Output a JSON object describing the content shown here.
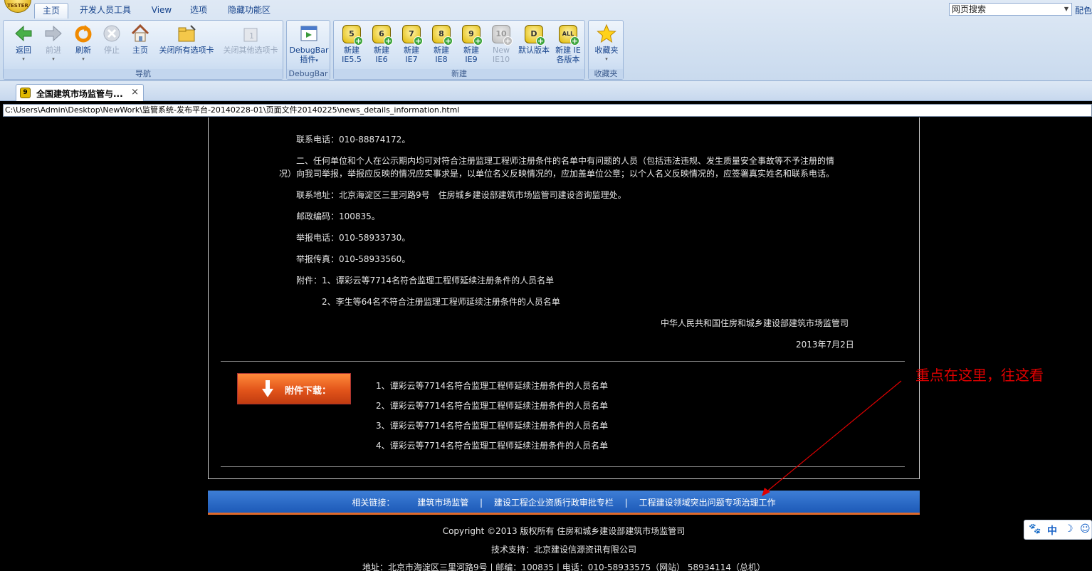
{
  "ribbon": {
    "logo_text": "TESTER",
    "tabs": [
      "主页",
      "开发人员工具",
      "View",
      "选项",
      "隐藏功能区"
    ],
    "search_value": "网页搜索",
    "config_label": "配色",
    "groups": {
      "nav": {
        "label": "导航",
        "buttons": [
          "返回",
          "前进",
          "刷新",
          "停止",
          "主页",
          "关闭所有选项卡",
          "关闭其他选项卡"
        ]
      },
      "debugbar": {
        "label": "DebugBar",
        "button_line1": "DebugBar",
        "button_line2": "插件"
      },
      "new": {
        "label": "新建",
        "buttons": [
          {
            "badge": "5",
            "line1": "新建",
            "line2": "IE5.5"
          },
          {
            "badge": "6",
            "line1": "新建",
            "line2": "IE6"
          },
          {
            "badge": "7",
            "line1": "新建",
            "line2": "IE7"
          },
          {
            "badge": "8",
            "line1": "新建",
            "line2": "IE8"
          },
          {
            "badge": "9",
            "line1": "新建",
            "line2": "IE9"
          },
          {
            "badge": "10",
            "line1": "New",
            "line2": "IE10"
          },
          {
            "badge": "D",
            "line1": "默认版本",
            "line2": ""
          },
          {
            "badge": "ALL",
            "line1": "新建 IE",
            "line2": "各版本"
          }
        ]
      },
      "fav": {
        "label": "收藏夹",
        "button": "收藏夹"
      }
    }
  },
  "doc_tab": {
    "icon_text": "9",
    "title": "全国建筑市场监管与...",
    "close": "×"
  },
  "address": "C:\\Users\\Admin\\Desktop\\NewWork\\监管系统-发布平台-20140228-01\\页面文件20140225\\news_details_information.html",
  "content": {
    "lines": [
      "联系电话：010-88874172。",
      "二、任何单位和个人在公示期内均可对符合注册监理工程师注册条件的名单中有问题的人员（包括违法违规、发生质量安全事故等不予注册的情",
      "况）向我司举报，举报应反映的情况应实事求是，以单位名义反映情况的，应加盖单位公章；以个人名义反映情况的，应签署真实姓名和联系电话。",
      "联系地址：北京海淀区三里河路9号　住房城乡建设部建筑市场监管司建设咨询监理处。",
      "邮政编码：100835。",
      "举报电话：010-58933730。",
      "举报传真：010-58933560。",
      "附件：1、谭彩云等7714名符合监理工程师延续注册条件的人员名单",
      "2、李生等64名不符合注册监理工程师延续注册条件的人员名单",
      "中华人民共和国住房和城乡建设部建筑市场监管司",
      "2013年7月2日"
    ],
    "download_label": "附件下载：",
    "attachments": [
      "1、谭彩云等7714名符合监理工程师延续注册条件的人员名单",
      "2、谭彩云等7714名符合监理工程师延续注册条件的人员名单",
      "3、谭彩云等7714名符合监理工程师延续注册条件的人员名单",
      "4、谭彩云等7714名符合监理工程师延续注册条件的人员名单"
    ]
  },
  "links_bar": {
    "label": "相关链接：",
    "links": [
      "建筑市场监管",
      "建设工程企业资质行政审批专栏",
      "工程建设领域突出问题专项治理工作"
    ],
    "separator": "|"
  },
  "footer": {
    "copyright": "Copyright ©2013 版权所有 住房和城乡建设部建筑市场监管司",
    "support": "技术支持：北京建设信源资讯有限公司",
    "address": "地址：北京市海淀区三里河路9号 | 邮编：100835 | 电话：010-58933575（网站） 58934114（总机）"
  },
  "annotation": "重点在这里，往这看",
  "ime": {
    "mode": "中"
  },
  "colors": {
    "annotation": "#e00000",
    "links_bar": "#2a6ac8",
    "download_button": "#e2541a"
  }
}
